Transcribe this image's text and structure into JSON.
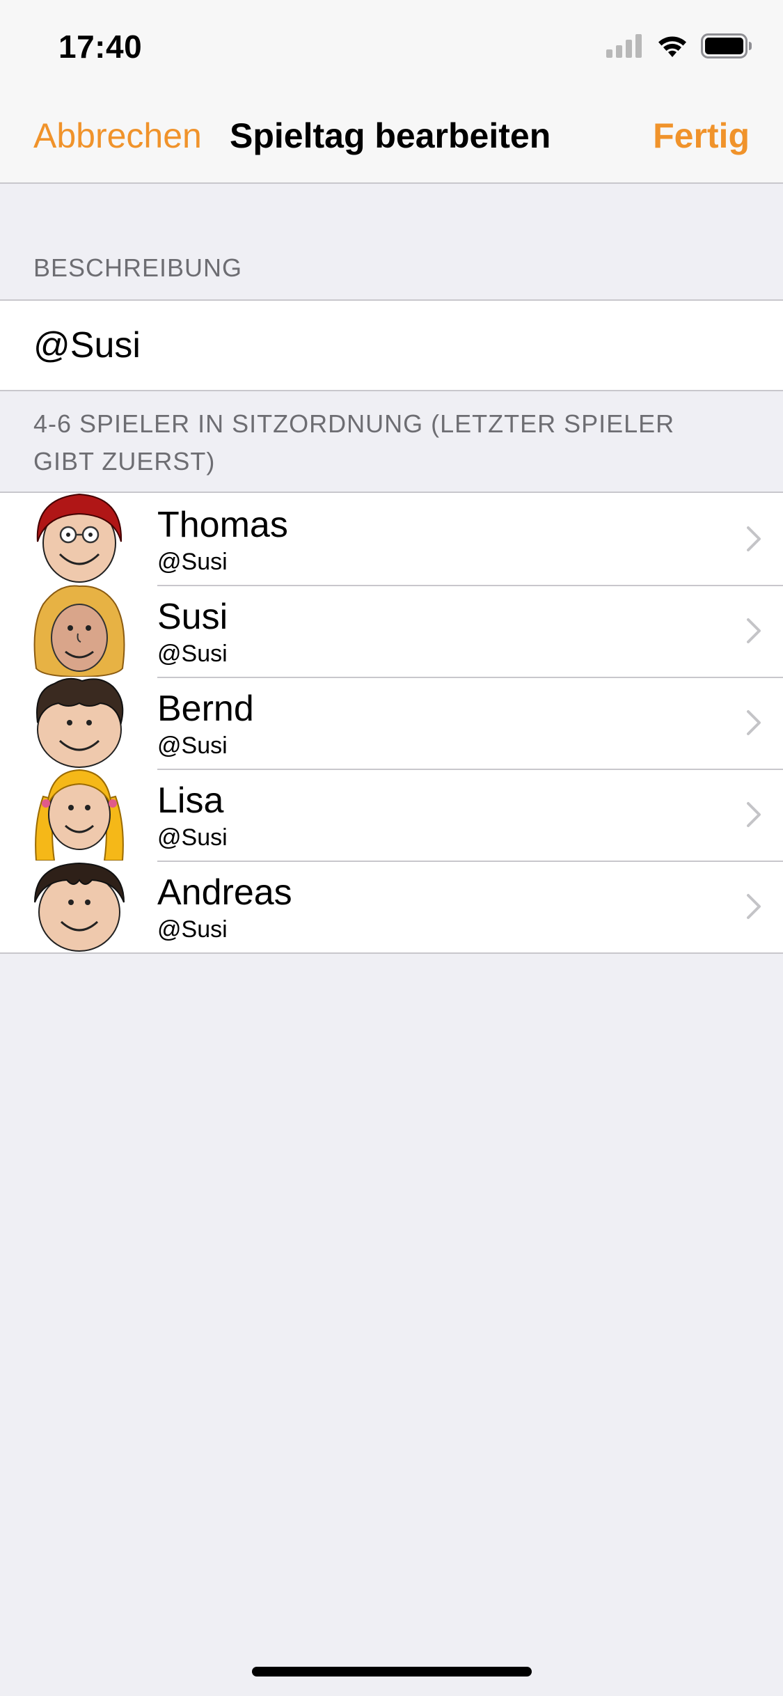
{
  "status_bar": {
    "time": "17:40",
    "icons": [
      "cellular-signal-icon",
      "wifi-icon",
      "battery-icon"
    ]
  },
  "nav": {
    "cancel_label": "Abbrechen",
    "title": "Spieltag bearbeiten",
    "done_label": "Fertig",
    "accent_color": "#f0932b"
  },
  "description_section": {
    "header": "BESCHREIBUNG",
    "value": "@Susi"
  },
  "players_section": {
    "header_line1": "4-6 SPIELER IN SITZORDNUNG (LETZTER SPIELER",
    "header_line2": "GIBT ZUERST)",
    "players": [
      {
        "name": "Thomas",
        "subtitle": "@Susi",
        "avatar": "red-hair-glasses-avatar"
      },
      {
        "name": "Susi",
        "subtitle": "@Susi",
        "avatar": "curly-blonde-avatar"
      },
      {
        "name": "Bernd",
        "subtitle": "@Susi",
        "avatar": "dark-curly-hair-avatar"
      },
      {
        "name": "Lisa",
        "subtitle": "@Susi",
        "avatar": "blonde-pigtails-avatar"
      },
      {
        "name": "Andreas",
        "subtitle": "@Susi",
        "avatar": "dark-straight-hair-avatar"
      }
    ]
  }
}
